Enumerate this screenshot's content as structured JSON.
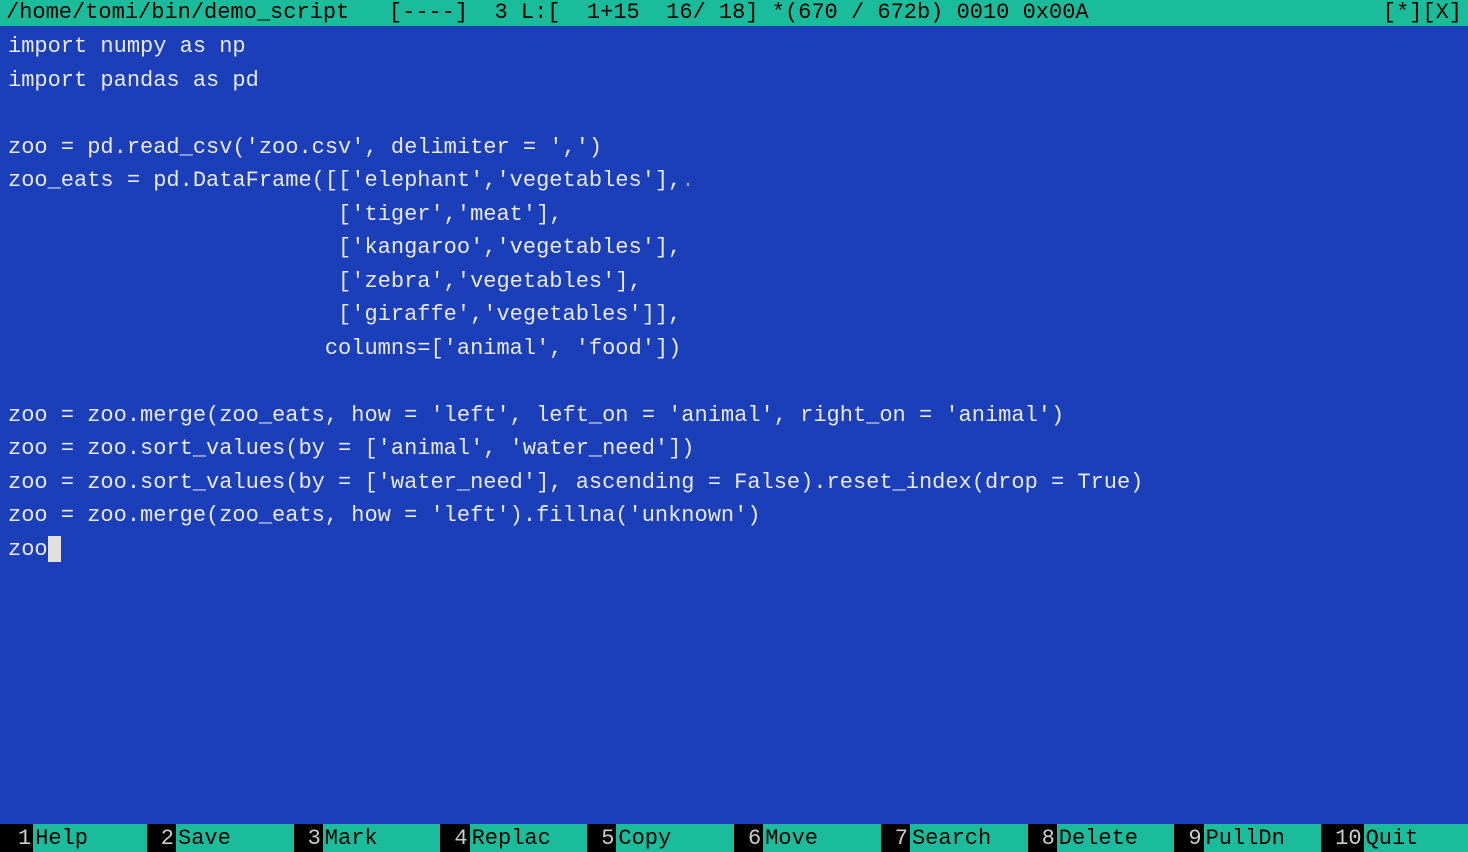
{
  "titlebar": {
    "path": "/home/tomi/bin/demo_script",
    "flags": "[----]",
    "status": "3 L:[  1+15  16/ 18] *(670 / 672b) 0010 0x00A",
    "right": "[*][X]"
  },
  "code": {
    "lines": [
      "import numpy as np",
      "import pandas as pd",
      "",
      "zoo = pd.read_csv('zoo.csv', delimiter = ',')",
      "zoo_eats = pd.DataFrame([['elephant','vegetables'],",
      "                         ['tiger','meat'],",
      "                         ['kangaroo','vegetables'],",
      "                         ['zebra','vegetables'],",
      "                         ['giraffe','vegetables']],",
      "                        columns=['animal', 'food'])",
      "",
      "zoo = zoo.merge(zoo_eats, how = 'left', left_on = 'animal', right_on = 'animal')",
      "zoo = zoo.sort_values(by = ['animal', 'water_need'])",
      "zoo = zoo.sort_values(by = ['water_need'], ascending = False).reset_index(drop = True)",
      "zoo = zoo.merge(zoo_eats, how = 'left').fillna('unknown')",
      "zoo"
    ],
    "cursor_line": 15,
    "wrap_dot_line": 4
  },
  "function_keys": [
    {
      "num": "1",
      "label": "Help"
    },
    {
      "num": "2",
      "label": "Save"
    },
    {
      "num": "3",
      "label": "Mark"
    },
    {
      "num": "4",
      "label": "Replac"
    },
    {
      "num": "5",
      "label": "Copy"
    },
    {
      "num": "6",
      "label": "Move"
    },
    {
      "num": "7",
      "label": "Search"
    },
    {
      "num": "8",
      "label": "Delete"
    },
    {
      "num": "9",
      "label": "PullDn"
    },
    {
      "num": "10",
      "label": "Quit"
    }
  ]
}
